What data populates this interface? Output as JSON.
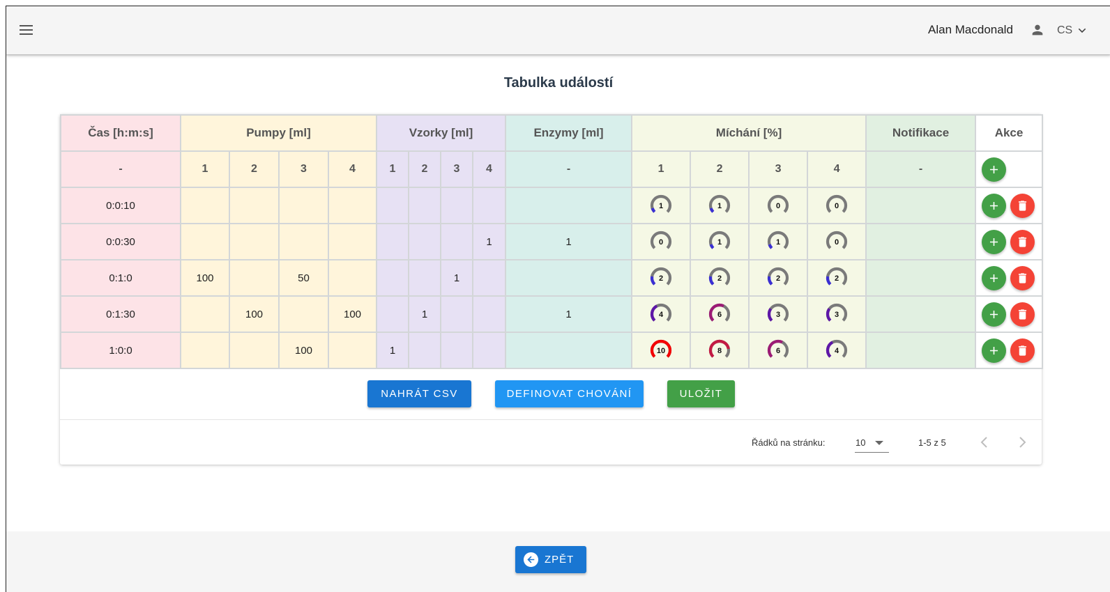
{
  "header": {
    "user_name": "Alan Macdonald",
    "language": "CS"
  },
  "page": {
    "title": "Tabulka událostí"
  },
  "table": {
    "groups": [
      {
        "key": "time",
        "label": "Čas [h:m:s]",
        "sublabels": [
          "-"
        ]
      },
      {
        "key": "pumps",
        "label": "Pumpy [ml]",
        "sublabels": [
          "1",
          "2",
          "3",
          "4"
        ]
      },
      {
        "key": "samples",
        "label": "Vzorky [ml]",
        "sublabels": [
          "1",
          "2",
          "3",
          "4"
        ]
      },
      {
        "key": "enzymes",
        "label": "Enzymy [ml]",
        "sublabels": [
          "-"
        ]
      },
      {
        "key": "mixing",
        "label": "Míchání [%]",
        "sublabels": [
          "1",
          "2",
          "3",
          "4"
        ]
      },
      {
        "key": "notifications",
        "label": "Notifikace",
        "sublabels": [
          "-"
        ]
      },
      {
        "key": "actions",
        "label": "Akce",
        "sublabels": []
      }
    ],
    "rows": [
      {
        "time": "0:0:10",
        "pumps": [
          "",
          "",
          "",
          ""
        ],
        "samples": [
          "",
          "",
          "",
          ""
        ],
        "enzymes": "",
        "mixing": [
          1,
          1,
          0,
          0
        ],
        "notification": ""
      },
      {
        "time": "0:0:30",
        "pumps": [
          "",
          "",
          "",
          ""
        ],
        "samples": [
          "",
          "",
          "",
          "1"
        ],
        "enzymes": "1",
        "mixing": [
          0,
          1,
          1,
          0
        ],
        "notification": ""
      },
      {
        "time": "0:1:0",
        "pumps": [
          "100",
          "",
          "50",
          ""
        ],
        "samples": [
          "",
          "",
          "1",
          ""
        ],
        "enzymes": "",
        "mixing": [
          2,
          2,
          2,
          2
        ],
        "notification": ""
      },
      {
        "time": "0:1:30",
        "pumps": [
          "",
          "100",
          "",
          "100"
        ],
        "samples": [
          "",
          "1",
          "",
          ""
        ],
        "enzymes": "1",
        "mixing": [
          4,
          6,
          3,
          3
        ],
        "notification": ""
      },
      {
        "time": "1:0:0",
        "pumps": [
          "",
          "",
          "100",
          ""
        ],
        "samples": [
          "1",
          "",
          "",
          ""
        ],
        "enzymes": "",
        "mixing": [
          10,
          8,
          6,
          4
        ],
        "notification": ""
      }
    ]
  },
  "buttons": {
    "upload_csv": "NAHRÁT CSV",
    "define_behavior": "DEFINOVAT CHOVÁNÍ",
    "save": "ULOŽIT",
    "back": "ZPĚT"
  },
  "pagination": {
    "rows_per_page_label": "Řádků na stránku:",
    "rows_per_page": "10",
    "range": "1-5 z 5"
  },
  "colors": {
    "time": "#fde3e7",
    "pumps": "#fff5db",
    "samples": "#e7e1f4",
    "enzymes": "#d8efeb",
    "mixing": "#f5f8e5",
    "notifications": "#e1f0e1",
    "primary": "#1976d2",
    "secondary": "#2196f3",
    "success": "#43a047",
    "danger": "#f44336",
    "gauge_track": "#7a7a7a"
  },
  "icons": {
    "menu": "hamburger-icon",
    "user": "person-icon",
    "lang": "chevron-down-icon",
    "add": "plus-icon",
    "delete": "trash-icon",
    "back": "arrow-left-circle-icon",
    "prev": "chevron-left-icon",
    "next": "chevron-right-icon"
  }
}
